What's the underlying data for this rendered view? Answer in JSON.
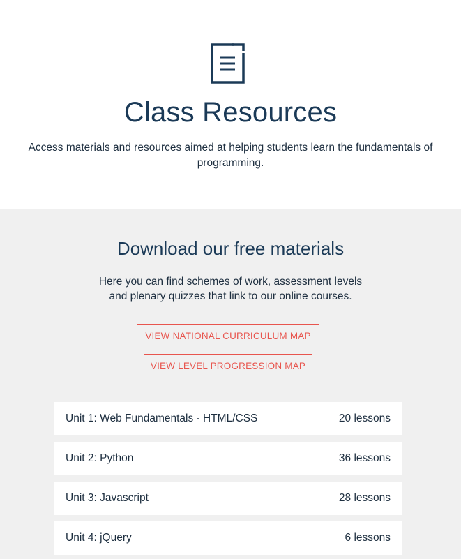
{
  "hero": {
    "title": "Class Resources",
    "subtitle": "Access materials and resources aimed at helping students learn the fundamentals of programming.",
    "icon": "document-icon"
  },
  "materials": {
    "title": "Download our free materials",
    "subtitle": "Here you can find schemes of work, assessment levels and plenary quizzes that link to our online courses.",
    "buttons": [
      {
        "label": "VIEW NATIONAL CURRICULUM MAP"
      },
      {
        "label": "VIEW LEVEL PROGRESSION MAP"
      }
    ],
    "units": [
      {
        "name": "Unit 1: Web Fundamentals - HTML/CSS",
        "lessons": "20 lessons"
      },
      {
        "name": "Unit 2: Python",
        "lessons": "36 lessons"
      },
      {
        "name": "Unit 3: Javascript",
        "lessons": "28 lessons"
      },
      {
        "name": "Unit 4: jQuery",
        "lessons": "6 lessons"
      }
    ]
  },
  "colors": {
    "navy": "#1b3a57",
    "accent": "#e8554e",
    "panel": "#f0f0f0",
    "card": "#ffffff"
  }
}
